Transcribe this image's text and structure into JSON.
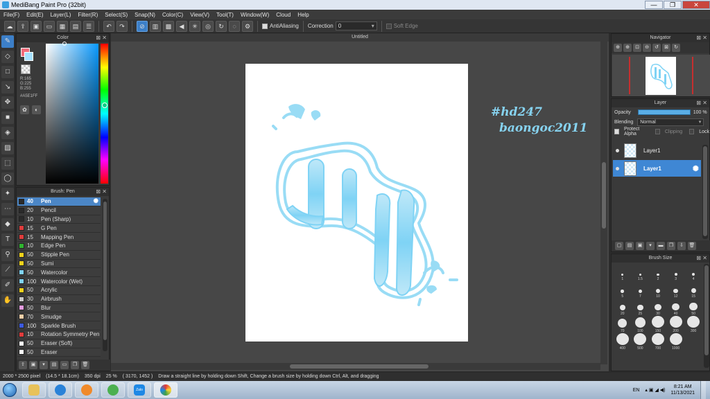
{
  "window": {
    "title": "MediBang Paint Pro (32bit)",
    "minimize": "—",
    "maximize": "❐",
    "close": "✕"
  },
  "menu": [
    "File(F)",
    "Edit(E)",
    "Layer(L)",
    "Filter(R)",
    "Select(S)",
    "Snap(N)",
    "Color(C)",
    "View(V)",
    "Tool(T)",
    "Window(W)",
    "Cloud",
    "Help"
  ],
  "toolbar": {
    "antialiasing_label": "AntiAliasing",
    "correction_label": "Correction",
    "correction_value": "0",
    "soft_edge_label": "Soft Edge"
  },
  "color_panel": {
    "title": "Color",
    "r": "R:165",
    "g": "G:225",
    "b": "B:255",
    "hex": "#A5E1FF",
    "accent": "#A5E1FF"
  },
  "brush_panel": {
    "title": "Brush: Pen",
    "items": [
      {
        "size": "40",
        "name": "Pen",
        "color": "#2a2a2a",
        "selected": true
      },
      {
        "size": "20",
        "name": "Pencil",
        "color": "#2a2a2a"
      },
      {
        "size": "10",
        "name": "Pen (Sharp)",
        "color": "#2a2a2a"
      },
      {
        "size": "15",
        "name": "G Pen",
        "color": "#e03c3c"
      },
      {
        "size": "15",
        "name": "Mapping Pen",
        "color": "#e03c3c"
      },
      {
        "size": "10",
        "name": "Edge Pen",
        "color": "#2fb52f"
      },
      {
        "size": "50",
        "name": "Stipple Pen",
        "color": "#f2d21b"
      },
      {
        "size": "50",
        "name": "Sumi",
        "color": "#f2d21b"
      },
      {
        "size": "50",
        "name": "Watercolor",
        "color": "#7fd3f5"
      },
      {
        "size": "100",
        "name": "Watercolor (Wet)",
        "color": "#7fd3f5"
      },
      {
        "size": "50",
        "name": "Acrylic",
        "color": "#f2d21b"
      },
      {
        "size": "30",
        "name": "Airbrush",
        "color": "#c8c8c8"
      },
      {
        "size": "50",
        "name": "Blur",
        "color": "#e59be0"
      },
      {
        "size": "70",
        "name": "Smudge",
        "color": "#f4cfa8"
      },
      {
        "size": "100",
        "name": "Sparkle Brush",
        "color": "#3c5ae0"
      },
      {
        "size": "10",
        "name": "Rotation Symmetry Pen",
        "color": "#e03c3c"
      },
      {
        "size": "50",
        "name": "Eraser (Soft)",
        "color": "#ffffff"
      },
      {
        "size": "50",
        "name": "Eraser",
        "color": "#ffffff"
      }
    ]
  },
  "canvas": {
    "tab_title": "Untitled",
    "overlay_line1": "#hd247",
    "overlay_line2": "baongoc2011"
  },
  "navigator": {
    "title": "Navigator"
  },
  "layer_panel": {
    "title": "Layer",
    "opacity_label": "Opacity",
    "opacity_value": "100 %",
    "blending_label": "Blending",
    "blending_value": "Normal",
    "protect_alpha": "Protect Alpha",
    "clipping": "Clipping",
    "lock": "Lock",
    "layers": [
      {
        "name": "Layer1",
        "selected": false
      },
      {
        "name": "Layer1",
        "selected": true
      }
    ]
  },
  "brush_size_panel": {
    "title": "Brush Size",
    "sizes": [
      "1",
      "1.5",
      "2",
      "3",
      "4",
      "5",
      "7",
      "10",
      "12",
      "15",
      "20",
      "25",
      "30",
      "40",
      "50",
      "70",
      "100",
      "150",
      "200",
      "300",
      "400",
      "500",
      "700",
      "1000"
    ]
  },
  "status": {
    "canvas_size": "2000 * 2500 pixel",
    "physical_size": "(14.5 * 18.1cm)",
    "dpi": "350 dpi",
    "zoom": "25 %",
    "cursor": "( 3170, 1452 )",
    "hint": "Draw a straight line by holding down Shift, Change a brush size by holding down Ctrl, Alt, and dragging"
  },
  "taskbar": {
    "lang": "EN",
    "time": "8:21 AM",
    "date": "11/13/2021",
    "zalo_label": "Zalo"
  }
}
